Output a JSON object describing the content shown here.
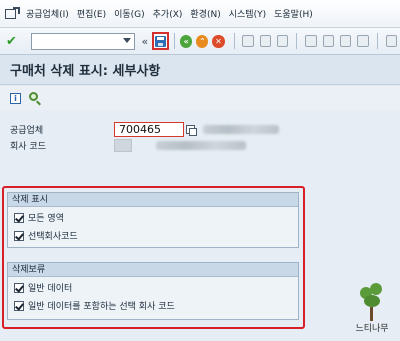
{
  "menubar": {
    "items": [
      {
        "label": "공급업체(I)"
      },
      {
        "label": "편집(E)"
      },
      {
        "label": "이동(G)"
      },
      {
        "label": "추가(X)"
      },
      {
        "label": "환경(N)"
      },
      {
        "label": "시스템(Y)"
      },
      {
        "label": "도움말(H)"
      }
    ]
  },
  "toolbar": {
    "command_value": "",
    "nav_symbol": "«"
  },
  "title": "구매처 삭제 표시: 세부사항",
  "fields": {
    "vendor_label": "공급업체",
    "vendor_value": "700465",
    "company_code_label": "회사 코드"
  },
  "groups": {
    "deletion_flag": {
      "title": "삭제 표시",
      "items": [
        {
          "label": "모든 영역"
        },
        {
          "label": "선택회사코드"
        }
      ]
    },
    "deletion_block": {
      "title": "삭제보류",
      "items": [
        {
          "label": "일반 데이터"
        },
        {
          "label": "일반 데이터를 포함하는 선택 회사 코드"
        }
      ]
    }
  },
  "watermark": "느티나무",
  "colors": {
    "highlight": "#d61f26",
    "ok_green": "#2f9a2a",
    "save_blue": "#2d6db5"
  }
}
